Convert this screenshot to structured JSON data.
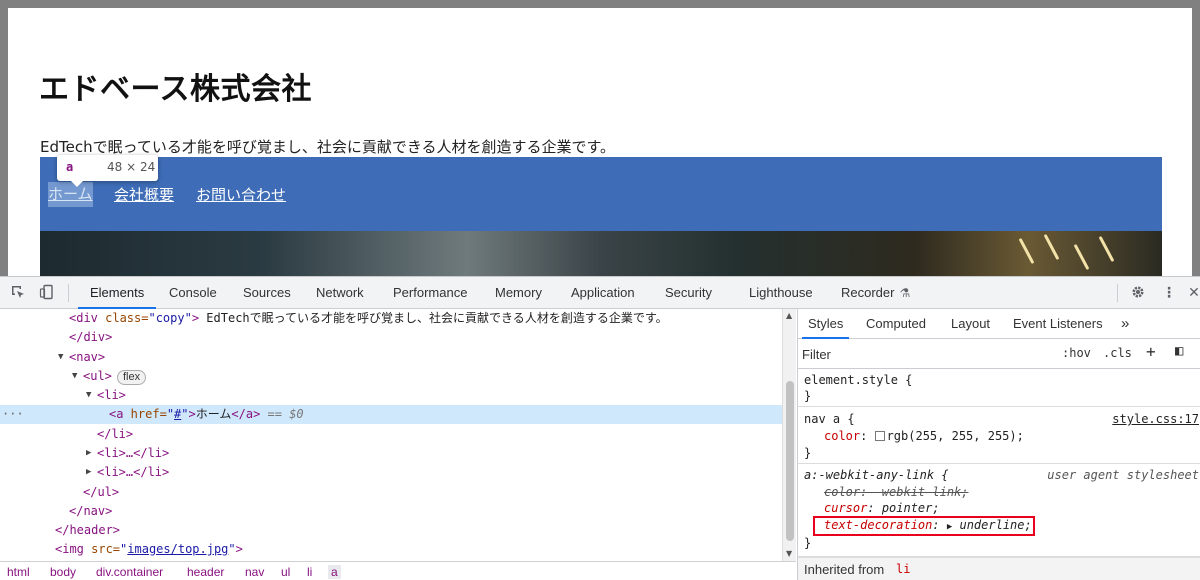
{
  "page": {
    "title": "エドベース株式会社",
    "copy": "EdTechで眠っている才能を呼び覚まし、社会に貢献できる人材を創造する企業です。",
    "nav": [
      "ホーム",
      "会社概要",
      "お問い合わせ"
    ],
    "tooltip": {
      "tag": "a",
      "size": "48 × 24"
    }
  },
  "devtools": {
    "tabs": [
      "Elements",
      "Console",
      "Sources",
      "Network",
      "Performance",
      "Memory",
      "Application",
      "Security",
      "Lighthouse",
      "Recorder"
    ],
    "active_tab": "Elements",
    "icons": {
      "inspect": "inspect-element-icon",
      "device": "device-toolbar-icon",
      "recorder": "flask-icon",
      "settings": "gear-icon",
      "more": "kebab-menu-icon",
      "close": "close-icon"
    },
    "dom": {
      "l1_tag_open": "<div",
      "l1_attr": " class=",
      "l1_val": "\"copy\"",
      "l1_close": ">",
      "l1_text": " EdTechで眠っている才能を呼び覚まし、社会に貢献できる人材を創造する企業です。",
      "l1_end": "</div>",
      "l2": "</div>",
      "l3": "<nav>",
      "l4": "<ul>",
      "l4_pill": "flex",
      "l5": "<li>",
      "l6_open": "<a",
      "l6_attr": " href=",
      "l6_q1": "\"",
      "l6_href": "#",
      "l6_q2": "\"",
      "l6_gt": ">",
      "l6_text": "ホーム",
      "l6_end": "</a>",
      "l6_dollar": " == $0",
      "l6_dots": "···",
      "l7": "</li>",
      "l8": "<li>…</li>",
      "l9": "<li>…</li>",
      "l10": "</ul>",
      "l11": "</nav>",
      "l12": "</header>",
      "l13_open": "<img",
      "l13_attr": " src=",
      "l13_q1": "\"",
      "l13_src": "images/top.jpg",
      "l13_q2": "\"",
      "l13_gt": ">"
    },
    "breadcrumbs": [
      "html",
      "body",
      "div.container",
      "header",
      "nav",
      "ul",
      "li",
      "a"
    ],
    "styles": {
      "tabs": [
        "Styles",
        "Computed",
        "Layout",
        "Event Listeners"
      ],
      "more_tabs": "»",
      "filter_placeholder": "Filter",
      "hov": ":hov",
      "cls": ".cls",
      "plus": "+",
      "toggle": "◧",
      "element_style": "element.style {",
      "close_brace": "}",
      "rule2_selector": "nav a {",
      "rule2_source": "style.css:17",
      "rule2_prop": "color",
      "rule2_value": "rgb(255, 255, 255);",
      "rule3_selector": "a:-webkit-any-link {",
      "rule3_source": "user agent stylesheet",
      "rule3_p1": "color",
      "rule3_v1": "-webkit-link;",
      "rule3_p2": "cursor",
      "rule3_v2": "pointer;",
      "rule3_p3": "text-decoration",
      "rule3_v3": "underline;",
      "inherited_label": "Inherited from",
      "inherited_tag": "li"
    }
  }
}
